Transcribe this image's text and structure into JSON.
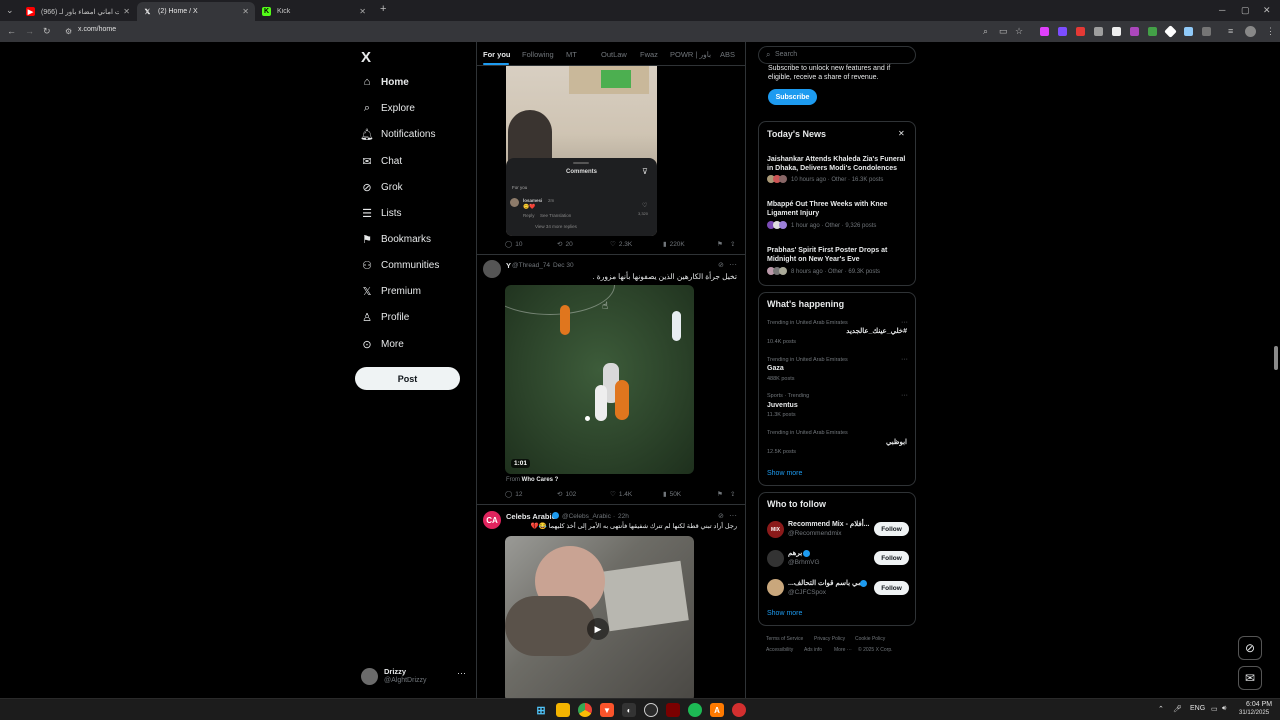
{
  "browser": {
    "tabs": [
      {
        "title": "(966) حقيقت اماني امضاء باور لـ",
        "active": false
      },
      {
        "title": "(2) Home / X",
        "active": true
      },
      {
        "title": "Kick",
        "active": false
      }
    ],
    "url": "x.com/home",
    "search_placeholder": "Search"
  },
  "nav": {
    "logo": "X",
    "items": [
      {
        "label": "Home",
        "icon": "home-icon"
      },
      {
        "label": "Explore",
        "icon": "search-icon"
      },
      {
        "label": "Notifications",
        "icon": "bell-icon"
      },
      {
        "label": "Chat",
        "icon": "mail-icon"
      },
      {
        "label": "Grok",
        "icon": "grok-icon"
      },
      {
        "label": "Lists",
        "icon": "list-icon"
      },
      {
        "label": "Bookmarks",
        "icon": "bookmark-icon"
      },
      {
        "label": "Communities",
        "icon": "people-icon"
      },
      {
        "label": "Premium",
        "icon": "x-logo-icon"
      },
      {
        "label": "Profile",
        "icon": "person-icon"
      },
      {
        "label": "More",
        "icon": "more-circle-icon"
      }
    ],
    "post_label": "Post",
    "account": {
      "name": "Drizzy",
      "handle": "@AlghtDrizzy"
    }
  },
  "feed": {
    "tabs": [
      "For you",
      "Following",
      "MT",
      "OutLaw",
      "Fwaz",
      "POWR | باور",
      "ABS"
    ],
    "tweet1": {
      "comments_overlay": {
        "title": "Comments",
        "sort": "For you",
        "comment_user": "losamesi",
        "comment_time": "2m",
        "comment_text": "😊❤️",
        "reply": "Reply",
        "see_translation": "See Translation",
        "likes": "3,320",
        "view_replies": "View 34 more replies"
      },
      "replies": "10",
      "reposts": "20",
      "likes": "2.3K",
      "views": "220K"
    },
    "tweet2": {
      "author": "Y",
      "handle": "@Thread_74",
      "time": "Dec 30",
      "text": "تخيل جرأة الكارهين الذين يصفونها بأنها مزورة .",
      "video_duration": "1:01",
      "from_prefix": "From",
      "from_name": "Who Cares ?",
      "replies": "12",
      "reposts": "102",
      "likes": "1.4K",
      "views": "50K"
    },
    "tweet3": {
      "author": "Celebs Arabic",
      "handle": "@Celebs_Arabic",
      "time": "22h",
      "text": "رجل أراد تبني قطة لكنها لم تترك شفيقها فأنتهى به الأمر إلى أخذ كليهما 😂💔"
    }
  },
  "sidebar": {
    "search_placeholder": "Search",
    "premium_text_1": "Subscribe to unlock new features and if",
    "premium_text_2": "eligible, receive a share of revenue.",
    "subscribe_label": "Subscribe",
    "news": {
      "title": "Today's News",
      "items": [
        {
          "headline": "Jaishankar Attends Khaleda Zia's Funeral in Dhaka, Delivers Modi's Condolences",
          "meta": "10 hours ago · Other · 16.3K posts"
        },
        {
          "headline": "Mbappé Out Three Weeks with Knee Ligament Injury",
          "meta": "1 hour ago · Other · 9,326 posts"
        },
        {
          "headline": "Prabhas' Spirit First Poster Drops at Midnight on New Year's Eve",
          "meta": "8 hours ago · Other · 69.3K posts"
        }
      ]
    },
    "happening": {
      "title": "What's happening",
      "items": [
        {
          "context": "Trending in United Arab Emirates",
          "name": "#خلي_عينك_عالجديد",
          "posts": "10.4K posts",
          "rtl": true
        },
        {
          "context": "Trending in United Arab Emirates",
          "name": "Gaza",
          "posts": "488K posts",
          "rtl": false
        },
        {
          "context": "Sports · Trending",
          "name": "Juventus",
          "posts": "11.3K posts",
          "rtl": false
        },
        {
          "context": "Trending in United Arab Emirates",
          "name": "ابوظبي",
          "posts": "12.5K posts",
          "rtl": true
        }
      ],
      "show_more": "Show more"
    },
    "who_to_follow": {
      "title": "Who to follow",
      "items": [
        {
          "name": "Recommend Mix - أفلام...",
          "handle": "@Recommendmix",
          "follow": "Follow"
        },
        {
          "name": "برهم",
          "handle": "@BrhmVG",
          "follow": "Follow"
        },
        {
          "name": "...مي باسم قوات التحالف",
          "handle": "@CJFCSpox",
          "follow": "Follow"
        }
      ],
      "show_more": "Show more"
    },
    "footer": [
      "Terms of Service",
      "Privacy Policy",
      "Cookie Policy",
      "Accessibility",
      "Ads info",
      "More ···",
      "© 2025 X Corp."
    ]
  },
  "taskbar": {
    "lang": "ENG",
    "time": "6:04 PM",
    "date": "31/12/2025"
  }
}
